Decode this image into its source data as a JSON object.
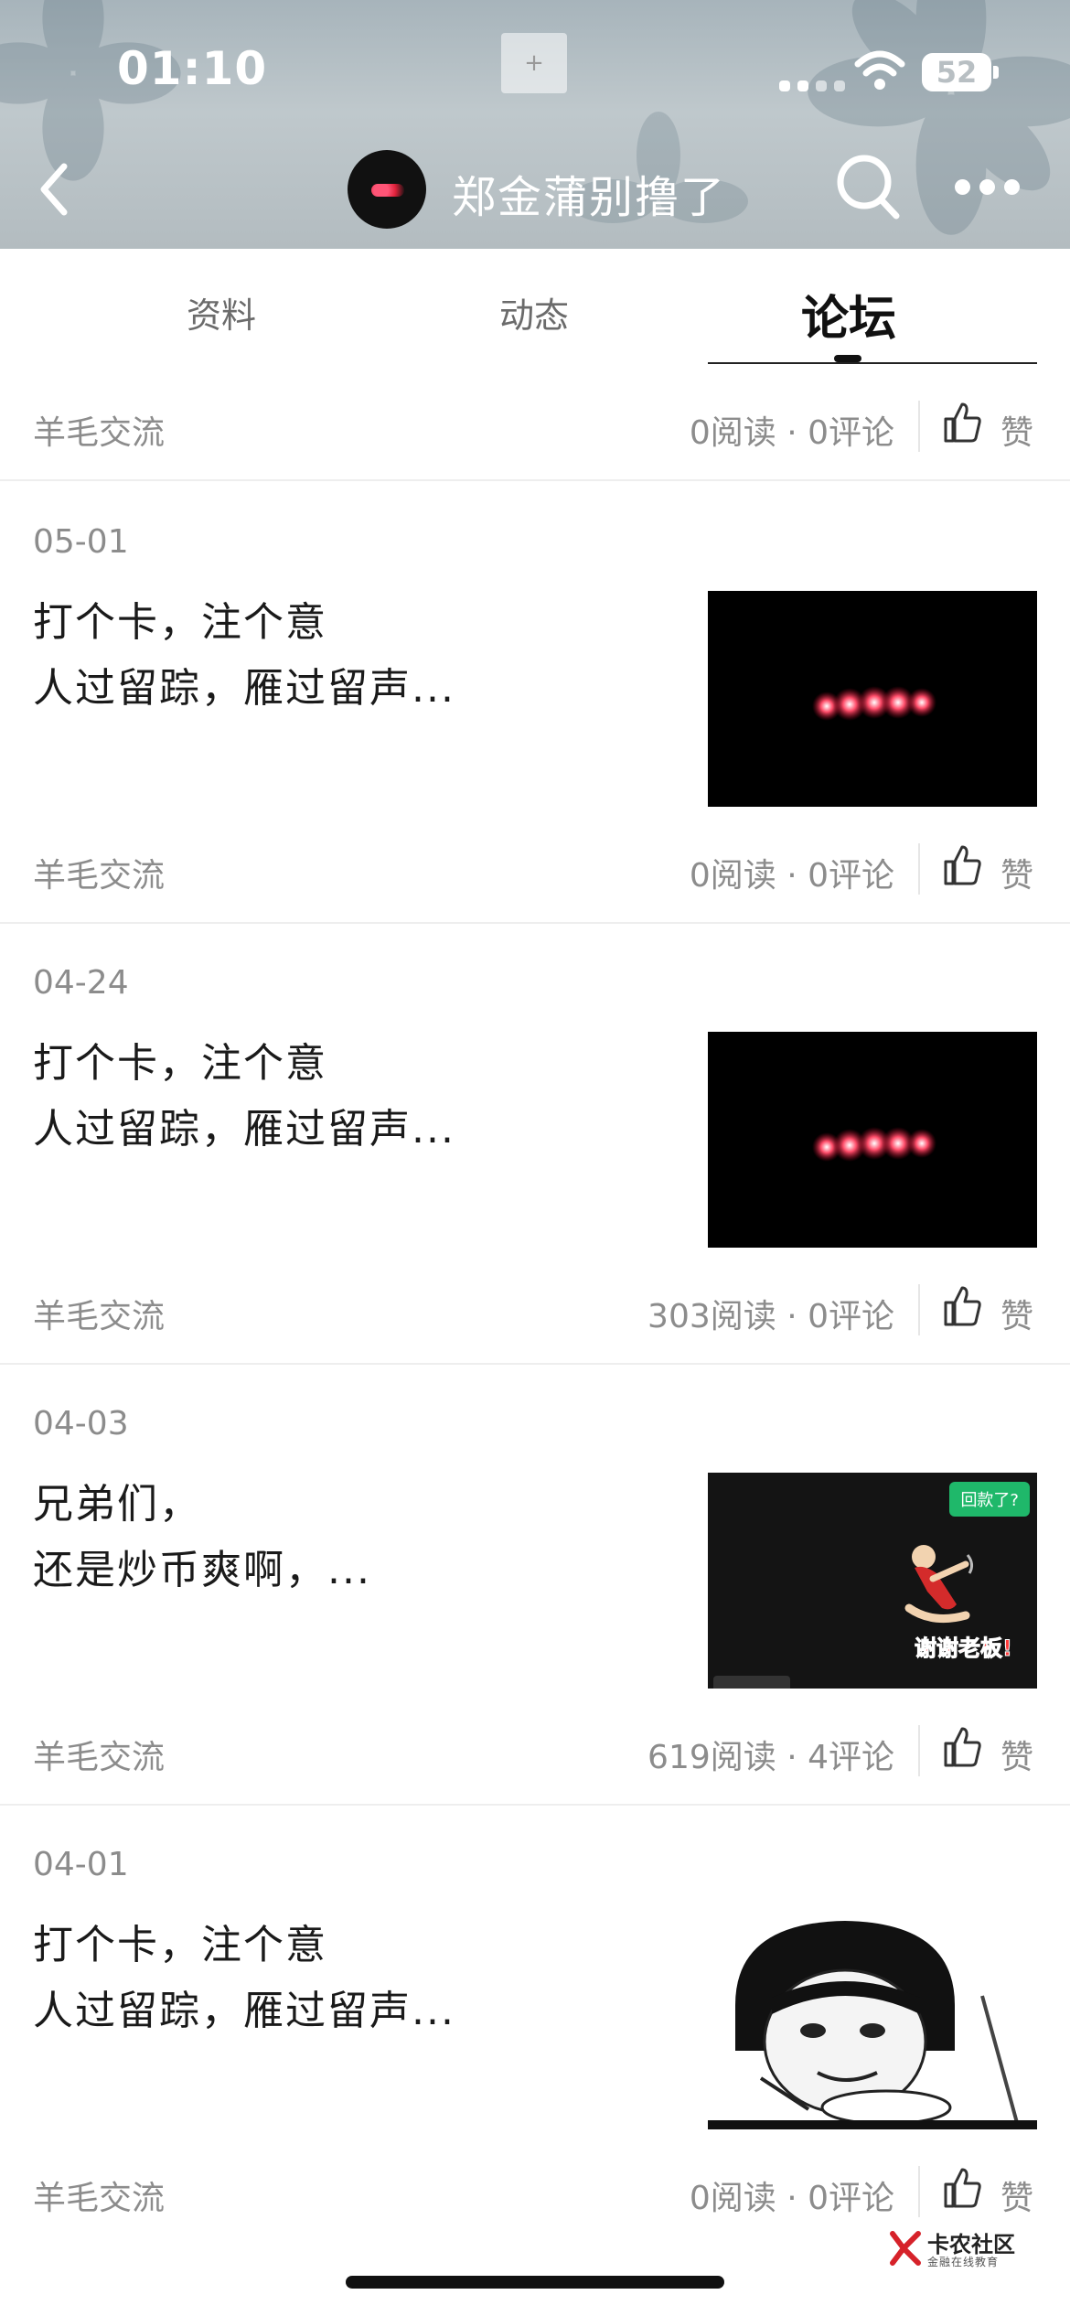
{
  "status_bar": {
    "time": "01:10",
    "battery": "52"
  },
  "header": {
    "title": "郑金蒲别撸了",
    "colors": {
      "icon": "#ffffff",
      "bg": "#b6c0c5"
    }
  },
  "tabs": [
    {
      "label": "资料"
    },
    {
      "label": "动态"
    },
    {
      "label": "论坛"
    }
  ],
  "active_tab": "论坛",
  "top_meta": {
    "category": "羊毛交流",
    "stats": "0阅读 · 0评论",
    "like": "赞"
  },
  "posts": [
    {
      "date": "05-01",
      "line1": "打个卡，注个意",
      "line2": "人过留踪，雁过留声...",
      "category": "羊毛交流",
      "stats": "0阅读 · 0评论",
      "like": "赞"
    },
    {
      "date": "04-24",
      "line1": "打个卡，注个意",
      "line2": "人过留踪，雁过留声...",
      "category": "羊毛交流",
      "stats": "303阅读 · 0评论",
      "like": "赞"
    },
    {
      "date": "04-03",
      "line1": "兄弟们，",
      "line2": "还是炒币爽啊，...",
      "category": "羊毛交流",
      "stats": "619阅读 · 4评论",
      "like": "赞",
      "thumb_badge": "回款了?",
      "thumb_caption": "谢谢老板!"
    },
    {
      "date": "04-01",
      "line1": "打个卡，注个意",
      "line2": "人过留踪，雁过留声...",
      "category": "羊毛交流",
      "stats": "0阅读 · 0评论",
      "like": "赞"
    }
  ],
  "watermark": {
    "title": "卡农社区",
    "subtitle": "金融在线教育"
  }
}
